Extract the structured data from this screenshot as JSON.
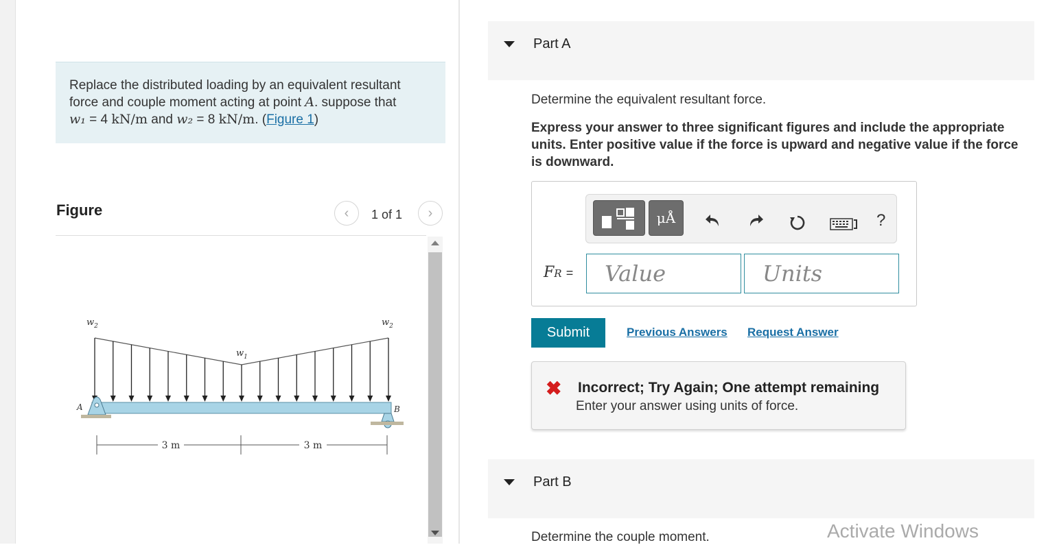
{
  "problem": {
    "text_before": "Replace the distributed loading by an equivalent resultant force and couple moment acting at point ",
    "point": "A",
    "text_mid": ". suppose that",
    "w1_sym": "w₁",
    "w1_val": "= 4",
    "w1_unit": "kN/m",
    "and_text": "and",
    "w2_sym": "w₂",
    "w2_val": "= 8",
    "w2_unit": "kN/m",
    "end_text": ". (",
    "figure_link": "Figure 1",
    "close_paren": ")"
  },
  "figure_panel": {
    "title": "Figure",
    "prev_icon": "‹",
    "next_icon": "›",
    "page_count": "1 of 1"
  },
  "beam_figure": {
    "w2_left": "w",
    "w2_left_sub": "2",
    "w2_right": "w",
    "w2_right_sub": "2",
    "w1": "w",
    "w1_sub": "1",
    "point_a": "A",
    "point_b": "B",
    "dim_left": "3 m",
    "dim_right": "3 m"
  },
  "part_a": {
    "label": "Part A",
    "prompt": "Determine the equivalent resultant force.",
    "instructions": "Express your answer to three significant figures and include the appropriate units. Enter positive value if the force is upward and negative value if the force is downward.",
    "variable_main": "F",
    "variable_sub": "R",
    "equals": "=",
    "value_placeholder": "Value",
    "units_placeholder": "Units",
    "toolbar": {
      "template_icon": "fraction-template-icon",
      "units_button": "μÅ",
      "undo_icon": "undo-icon",
      "redo_icon": "redo-icon",
      "reset_icon": "reset-icon",
      "keyboard_icon": "keyboard-icon",
      "help": "?"
    },
    "submit_label": "Submit",
    "previous_answers": "Previous Answers",
    "request_answer": "Request Answer",
    "feedback": {
      "icon": "✖",
      "title": "Incorrect; Try Again; One attempt remaining",
      "message": "Enter your answer using units of force."
    }
  },
  "part_b": {
    "label": "Part B",
    "prompt": "Determine the couple moment."
  },
  "watermark": "Activate Windows",
  "colors": {
    "accent": "#077c96",
    "link": "#1a6fa5",
    "problem_bg": "#e6f1f4",
    "beam": "#a8d4e6",
    "error": "#d41c1c"
  }
}
